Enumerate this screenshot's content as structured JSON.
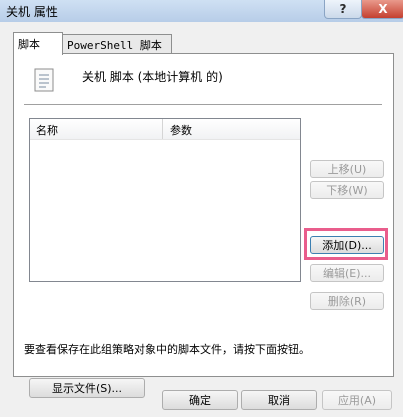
{
  "window": {
    "title": "关机 属性",
    "help_label": "?",
    "close_label": "X"
  },
  "tabs": [
    {
      "label": "脚本"
    },
    {
      "label": "PowerShell 脚本"
    }
  ],
  "panel": {
    "heading": "关机 脚本 (本地计算机 的)",
    "columns": [
      "名称",
      "参数"
    ],
    "rows": [],
    "buttons": {
      "move_up": "上移(U)",
      "move_down": "下移(W)",
      "add": "添加(D)...",
      "edit": "编辑(E)...",
      "remove": "删除(R)"
    },
    "info_text": "要查看保存在此组策略对象中的脚本文件，请按下面按钮。",
    "show_files": "显示文件(S)..."
  },
  "footer": {
    "ok": "确定",
    "cancel": "取消",
    "apply": "应用(A)"
  },
  "icons": {
    "script": "script-document-icon"
  },
  "colors": {
    "highlight": "#e95d8c"
  }
}
